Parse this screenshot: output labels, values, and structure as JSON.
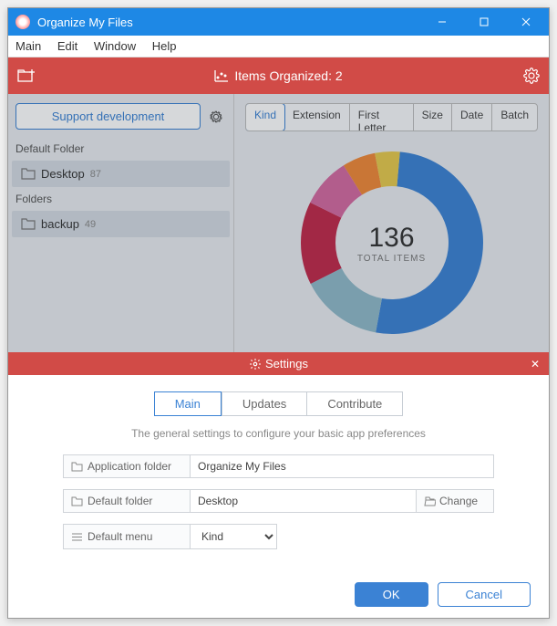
{
  "titlebar": {
    "title": "Organize My Files"
  },
  "menubar": {
    "items": [
      "Main",
      "Edit",
      "Window",
      "Help"
    ]
  },
  "statusbar": {
    "text": "Items Organized: 2"
  },
  "sidebar": {
    "support_label": "Support development",
    "group1_label": "Default Folder",
    "group1_item": {
      "name": "Desktop",
      "count": "87"
    },
    "group2_label": "Folders",
    "group2_item": {
      "name": "backup",
      "count": "49"
    }
  },
  "tabs": {
    "items": [
      "Kind",
      "Extension",
      "First Letter",
      "Size",
      "Date",
      "Batch"
    ],
    "active": 0
  },
  "donut": {
    "value": "136",
    "label": "TOTAL ITEMS"
  },
  "chart_data": {
    "type": "pie",
    "title": "Total Items",
    "total": 136,
    "series": [
      {
        "name": "segment-blue",
        "color": "#3b82d4",
        "value": 70
      },
      {
        "name": "segment-teal",
        "color": "#8fb9c9",
        "value": 20
      },
      {
        "name": "segment-crimson",
        "color": "#c0294a",
        "value": 20
      },
      {
        "name": "segment-pink",
        "color": "#d469a0",
        "value": 12
      },
      {
        "name": "segment-orange",
        "color": "#f08838",
        "value": 8
      },
      {
        "name": "segment-yellow",
        "color": "#e6c84c",
        "value": 6
      }
    ]
  },
  "settings": {
    "panel_title": "Settings",
    "tabs": [
      "Main",
      "Updates",
      "Contribute"
    ],
    "desc": "The general settings to configure your basic app preferences",
    "row1_label": "Application folder",
    "row1_value": "Organize My Files",
    "row2_label": "Default folder",
    "row2_value": "Desktop",
    "row2_button": "Change",
    "row3_label": "Default menu",
    "row3_value": "Kind",
    "ok": "OK",
    "cancel": "Cancel"
  }
}
